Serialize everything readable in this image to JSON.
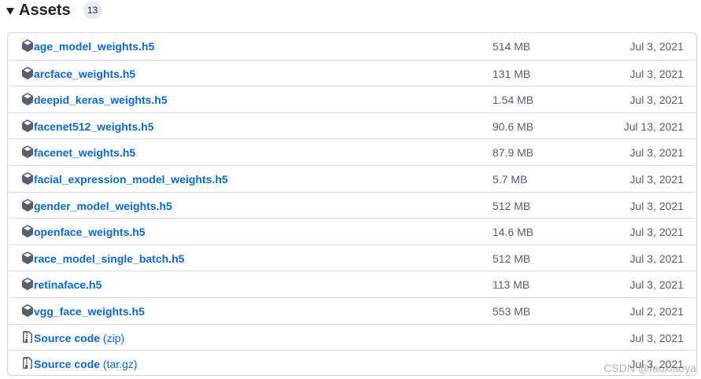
{
  "header": {
    "title": "Assets",
    "count": "13"
  },
  "assets": [
    {
      "name": "age_model_weights.h5",
      "size": "514 MB",
      "date": "Jul 3, 2021",
      "icon": "package-icon"
    },
    {
      "name": "arcface_weights.h5",
      "size": "131 MB",
      "date": "Jul 3, 2021",
      "icon": "package-icon"
    },
    {
      "name": "deepid_keras_weights.h5",
      "size": "1.54 MB",
      "date": "Jul 3, 2021",
      "icon": "package-icon"
    },
    {
      "name": "facenet512_weights.h5",
      "size": "90.6 MB",
      "date": "Jul 13, 2021",
      "icon": "package-icon"
    },
    {
      "name": "facenet_weights.h5",
      "size": "87.9 MB",
      "date": "Jul 3, 2021",
      "icon": "package-icon"
    },
    {
      "name": "facial_expression_model_weights.h5",
      "size": "5.7 MB",
      "date": "Jul 3, 2021",
      "icon": "package-icon"
    },
    {
      "name": "gender_model_weights.h5",
      "size": "512 MB",
      "date": "Jul 3, 2021",
      "icon": "package-icon"
    },
    {
      "name": "openface_weights.h5",
      "size": "14.6 MB",
      "date": "Jul 3, 2021",
      "icon": "package-icon"
    },
    {
      "name": "race_model_single_batch.h5",
      "size": "512 MB",
      "date": "Jul 3, 2021",
      "icon": "package-icon"
    },
    {
      "name": "retinaface.h5",
      "size": "113 MB",
      "date": "Jul 3, 2021",
      "icon": "package-icon"
    },
    {
      "name": "vgg_face_weights.h5",
      "size": "553 MB",
      "date": "Jul 2, 2021",
      "icon": "package-icon"
    },
    {
      "name": "Source code",
      "suffix": "(zip)",
      "size": "",
      "date": "Jul 3, 2021",
      "icon": "file-zip-icon"
    },
    {
      "name": "Source code",
      "suffix": "(tar.gz)",
      "size": "",
      "date": "Jul 3, 2021",
      "icon": "file-zip-icon"
    }
  ],
  "watermark": "CSDN @faoxiaoya"
}
